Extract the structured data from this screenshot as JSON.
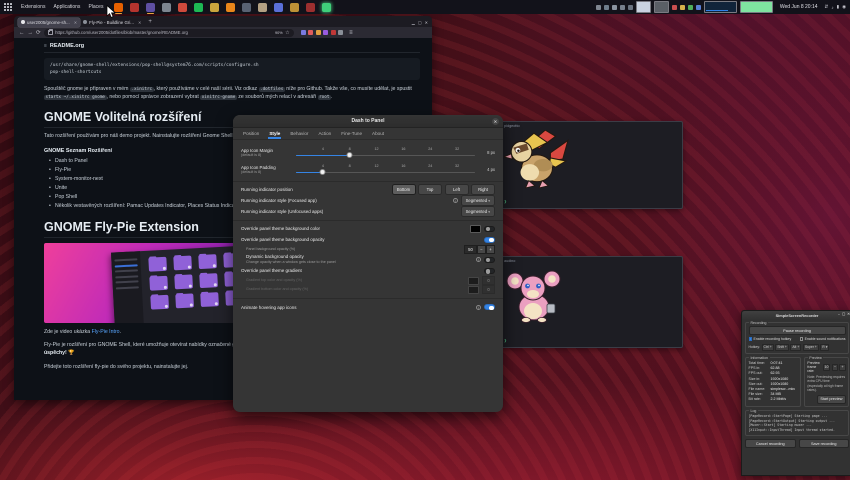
{
  "topbar": {
    "menus": [
      "Extensions",
      "Applications",
      "Places"
    ],
    "clock": "Wed Jun 8 20:14",
    "app_icons": [
      {
        "name": "firefox",
        "color": "#e66000"
      },
      {
        "name": "security-shield",
        "color": "#b5342e"
      },
      {
        "name": "text-editor",
        "color": "#5e4fa2"
      },
      {
        "name": "files",
        "color": "#7d8590"
      },
      {
        "name": "calendar",
        "color": "#cf4a3c"
      },
      {
        "name": "spotify",
        "color": "#1db954"
      },
      {
        "name": "camera",
        "color": "#caa53d"
      },
      {
        "name": "vlc",
        "color": "#e8861a"
      },
      {
        "name": "package-manager",
        "color": "#596273"
      },
      {
        "name": "file-manager",
        "color": "#b3a083"
      },
      {
        "name": "system-settings",
        "color": "#5a6fd8"
      },
      {
        "name": "archive",
        "color": "#bd9136"
      },
      {
        "name": "video-player",
        "color": "#9c2f2f"
      },
      {
        "name": "screen-recorder",
        "color": "#3fd07a"
      }
    ],
    "tray_icons": [
      {
        "name": "tray-1",
        "color": "#7f8691"
      },
      {
        "name": "tray-2",
        "color": "#6f7d8c"
      },
      {
        "name": "tray-3",
        "color": "#8a93a0"
      },
      {
        "name": "tray-4",
        "color": "#77808d"
      },
      {
        "name": "tray-5",
        "color": "#69727f"
      },
      {
        "name": "tray-6",
        "color": "#c94f4f"
      },
      {
        "name": "tray-7",
        "color": "#d6b24a"
      },
      {
        "name": "tray-8",
        "color": "#4fae5c"
      },
      {
        "name": "tray-9",
        "color": "#5a7fd6"
      }
    ],
    "window_previews": [
      {
        "name": "preview-light",
        "color": "#c9d2e0"
      },
      {
        "name": "preview-gray",
        "color": "#5a5f66"
      },
      {
        "name": "preview-terminal",
        "color": "#11243a"
      },
      {
        "name": "preview-green",
        "color": "#7fe3a0"
      }
    ],
    "status_icons": {
      "network": "⇵",
      "volume": "♪",
      "battery": "▮",
      "power": "◉"
    }
  },
  "browser": {
    "tab1": "user2005/gnome-sh...",
    "tab2": "Fly-Pie - Buildline Gri...",
    "new_tab": "+",
    "back": "←",
    "forward": "→",
    "reload": "⟳",
    "url": "https://github.com/user2005/dotfiles/blob/master/gnome/README.org",
    "zoom_level": "90%",
    "bookmark_star": "☆",
    "menu_icon": "≡",
    "extension_icons": [
      {
        "name": "ext-blue",
        "color": "#7a7ae0"
      },
      {
        "name": "ext-red",
        "color": "#e05c5c"
      },
      {
        "name": "ext-orange",
        "color": "#e0a040"
      },
      {
        "name": "ext-purple",
        "color": "#9a5ce0"
      },
      {
        "name": "ext-darkred",
        "color": "#c03838"
      },
      {
        "name": "ext-gray",
        "color": "#8a8f98"
      }
    ],
    "window_controls": {
      "minimize": "▁",
      "maximize": "▢",
      "close": "✕"
    }
  },
  "readme": {
    "file_icon": "≡",
    "filename": "README.org",
    "code_line1": "/usr/share/gnome-shell/extensions/pop-shell@system76.com/scripts/configure.sh",
    "code_line2": "pop-shell-shortcuts",
    "p1": [
      {
        "t": "Spouštěč gnome je připraven v mém "
      },
      {
        "c": ".xinitrc"
      },
      {
        "t": ", který používáme v celé naší sérii. Viz odkaz "
      },
      {
        "c": ".dotfiles"
      },
      {
        "t": " níže pro Github. Takže vše, co musíte udělat, je spustit "
      },
      {
        "c": "startx ~/.xinitrc gnome"
      },
      {
        "t": ", nebo pomocí správce zobrazení vybrat "
      },
      {
        "c": "xinitrc-gnome"
      },
      {
        "t": " ze souborů mých relací v adresáři "
      },
      {
        "c": "root"
      },
      {
        "t": "."
      }
    ],
    "h1a": "GNOME Volitelná rozšíření",
    "p2": "Tato rozšíření používám pro náš demo projekt. Nainstalujte rozšíření Gnome Shell z odkazů níže.",
    "h4": "GNOME Seznam Rozšíření",
    "bullets": [
      "Dash to Panel",
      "Fly-Pie",
      "System-monitor-next",
      "Unite",
      "Pop Shell",
      "Několik vestavěných rozšíření: Pamac Updates Indicator, Places Status Indicator"
    ],
    "h1b": "GNOME Fly-Pie Extension",
    "p3a": "Zde je video ukázka ",
    "p3link": "Fly-Pie Intro",
    "p3b": ".",
    "p4a": "Fly-Pie je rozšíření pro GNOME Shell, které umožňuje otevírat nabídky označené gestem myši. Mějte na vědomí — je to ",
    "p4b": "první rozšíření GNOME Shell s úspěchy!",
    "p4c": " 🏆",
    "p5": "Přidejte toto rozšíření fly-pie do svého projektu, nainstalujte jej."
  },
  "dialog": {
    "title": "Dash to Panel",
    "close": "✕",
    "tabs": [
      "Position",
      "Style",
      "Behavior",
      "Action",
      "Fine-Tune",
      "About"
    ],
    "active_tab": "Style",
    "margin": {
      "label": "App Icon Margin",
      "sub": "(default is 8)",
      "ticks": [
        "4",
        "8",
        "12",
        "16",
        "24",
        "32"
      ],
      "value": "8 px"
    },
    "padding": {
      "label": "App Icon Padding",
      "sub": "(default is 8)",
      "ticks": [
        "4",
        "8",
        "12",
        "16",
        "24",
        "32"
      ],
      "value": "4 px"
    },
    "indicator_position": {
      "label": "Running indicator position",
      "options": [
        "Bottom",
        "Top",
        "Left",
        "Right"
      ],
      "selected": "Bottom"
    },
    "focused_style": {
      "label": "Running indicator style (Focused app)",
      "value": "Segmented",
      "arrow": "▾",
      "info": "i"
    },
    "unfocused_style": {
      "label": "Running indicator style (Unfocused apps)",
      "value": "Segmented",
      "arrow": "▾"
    },
    "bg_color": {
      "label": "Override panel theme background color",
      "toggle": "off"
    },
    "bg_opacity": {
      "label": "Override panel theme background opacity",
      "toggle": "on"
    },
    "panel_opacity": {
      "label": "Panel background opacity (%)",
      "value": "50",
      "minus": "−",
      "plus": "+"
    },
    "dynamic_opacity": {
      "label": "Dynamic background opacity",
      "sub": "Change opacity when a window gets close to the panel",
      "toggle": "off",
      "info": "i"
    },
    "gradient": {
      "label": "Override panel theme gradient",
      "toggle": "off"
    },
    "gradient_top": {
      "label": "Gradient top color and opacity (%)",
      "value": "0"
    },
    "gradient_bottom": {
      "label": "Gradient bottom color and opacity (%)",
      "value": "0"
    },
    "animate_hover": {
      "label": "Animate hovering app icons",
      "toggle": "on",
      "info": "i"
    }
  },
  "terminals": [
    {
      "title": "pidgeotto",
      "prompt": "❯"
    },
    {
      "title": "audino",
      "prompt": "❯"
    }
  ],
  "recorder": {
    "title": "SimpleScreenRecorder",
    "controls": {
      "minimize": "–",
      "maximize": "▢",
      "close": "✕"
    },
    "recording_group": "Recording",
    "pause_button": "Pause recording",
    "hotkey_enable": "Enable recording hotkey",
    "sound_enable": "Enable sound notifications",
    "hotkey_label": "Hotkey:",
    "hotkey_mods": [
      "Ctrl +",
      "Shift +",
      "Alt +",
      "Super +"
    ],
    "hotkey_key": "R ▾",
    "info_group": "Information",
    "info_rows": [
      {
        "k": "Total time:",
        "v": "0:07:41"
      },
      {
        "k": "FPS in:",
        "v": "62.88"
      },
      {
        "k": "FPS out:",
        "v": "62.93"
      },
      {
        "k": "Size in:",
        "v": "1920x1080"
      },
      {
        "k": "Size out:",
        "v": "1920x1080"
      },
      {
        "k": "File name:",
        "v": "simplescr...mkv"
      },
      {
        "k": "File size:",
        "v": "34 MB"
      },
      {
        "k": "Bit rate:",
        "v": "2.2 Mbit/s"
      }
    ],
    "preview_group": "Preview",
    "frame_rate_label": "Preview frame rate:",
    "frame_rate": "10",
    "minus": "−",
    "plus": "+",
    "note": "Note: Previewing requires extra CPU time (especially at high frame rates).",
    "preview_button": "Start preview",
    "log_group": "Log",
    "log_lines": [
      "[PageRecord::StartPage] Starting page ...",
      "[PageRecord::StartOutput] Starting output ...",
      "[Muxer::Start] Starting muxer ...",
      "[X11Input::InputThread] Input thread started."
    ],
    "cancel_button": "Cancel recording",
    "save_button": "Save recording"
  }
}
